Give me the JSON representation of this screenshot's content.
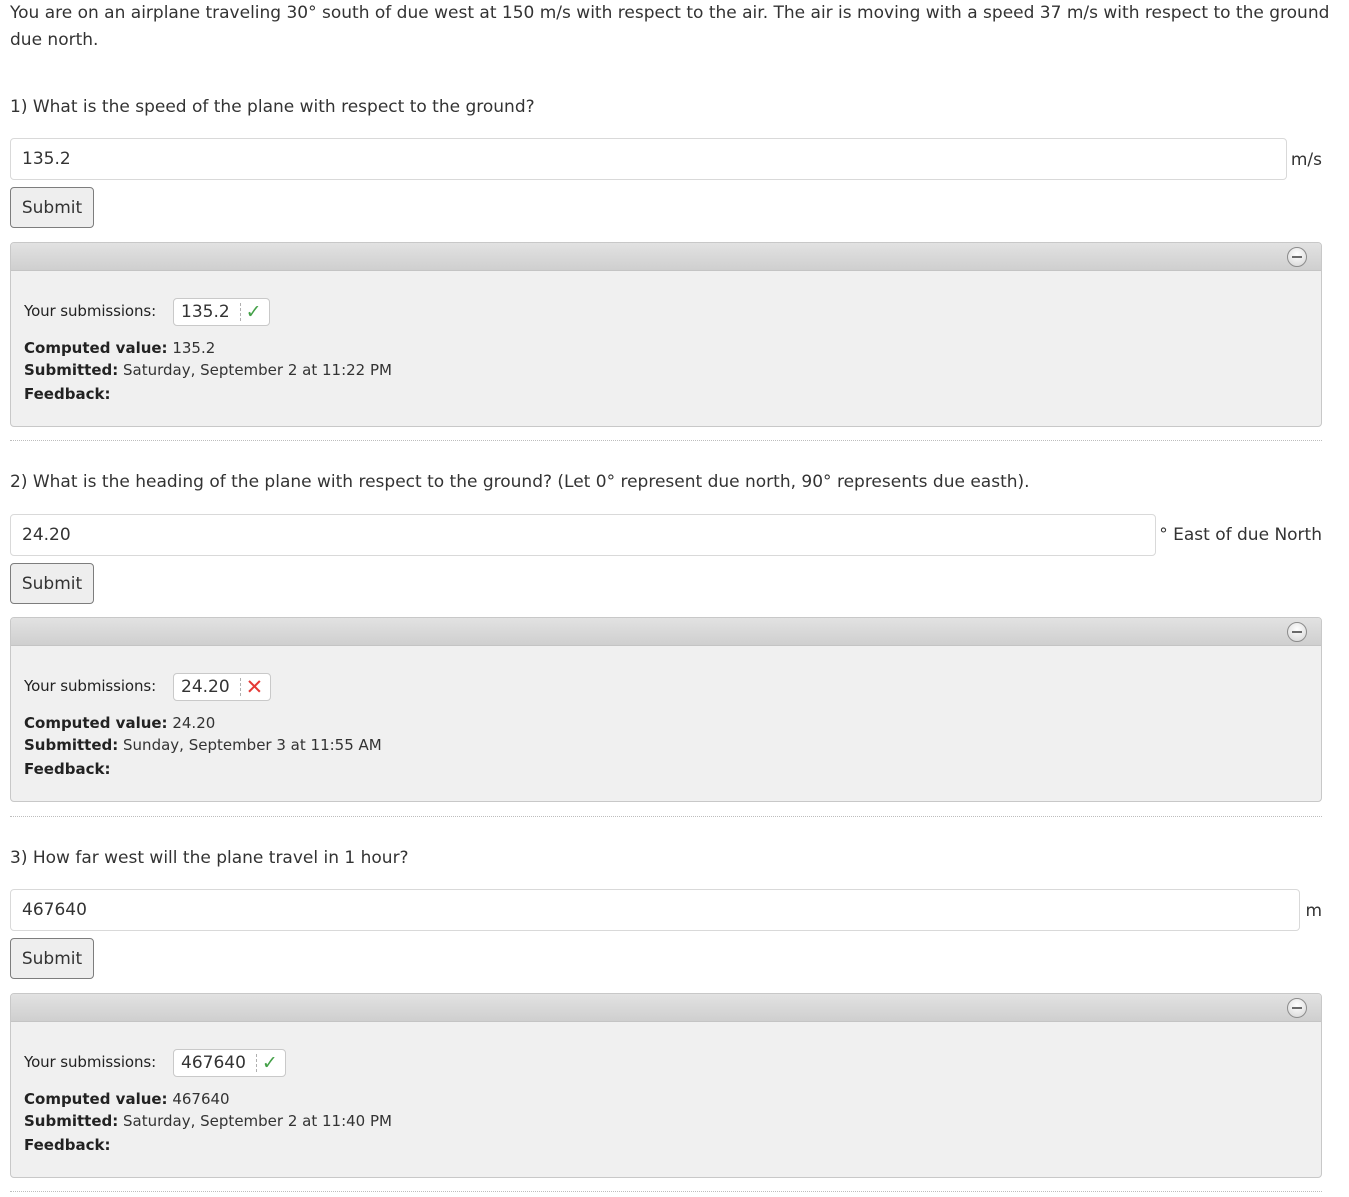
{
  "intro": "You are on an airplane traveling 30° south of due west at 150 m/s with respect to the air. The air is moving with a speed 37 m/s with respect to the ground due north.",
  "labels": {
    "your_submissions": "Your submissions:",
    "computed_value": "Computed value:",
    "submitted": "Submitted:",
    "feedback": "Feedback:"
  },
  "parts": [
    {
      "question": "1) What is the speed of the plane with respect to the ground?",
      "input_value": "135.2",
      "unit": "m/s",
      "submit_label": "Submit",
      "submission": {
        "value": "135.2",
        "status": "correct",
        "status_icon": "check-icon"
      },
      "computed_value": "135.2",
      "submitted": "Saturday, September 2 at 11:22 PM",
      "feedback": ""
    },
    {
      "question": "2) What is the heading of the plane with respect to the ground? (Let 0° represent due north, 90° represents due easth).",
      "input_value": "24.20",
      "unit": "° East of due North",
      "submit_label": "Submit",
      "submission": {
        "value": "24.20",
        "status": "incorrect",
        "status_icon": "cross-icon"
      },
      "computed_value": "24.20",
      "submitted": "Sunday, September 3 at 11:55 AM",
      "feedback": ""
    },
    {
      "question": "3) How far west will the plane travel in 1 hour?",
      "input_value": "467640",
      "unit": "m",
      "submit_label": "Submit",
      "submission": {
        "value": "467640",
        "status": "correct",
        "status_icon": "check-icon"
      },
      "computed_value": "467640",
      "submitted": "Saturday, September 2 at 11:40 PM",
      "feedback": ""
    }
  ],
  "colors": {
    "correct": "#43a047",
    "incorrect": "#e53935",
    "panel_bg": "#f0f0f0"
  }
}
